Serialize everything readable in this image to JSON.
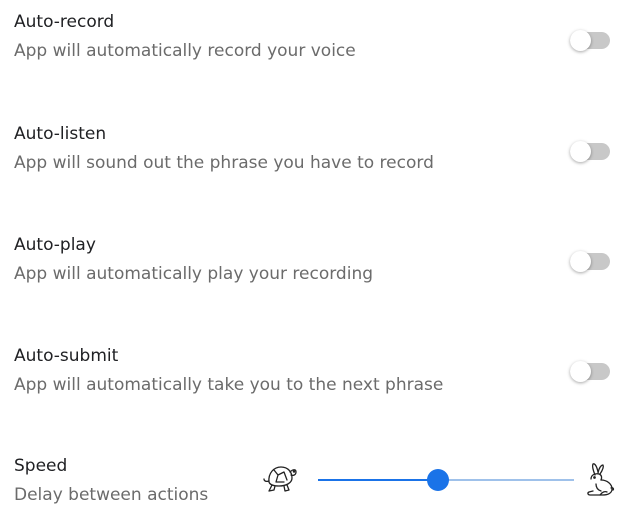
{
  "settings": [
    {
      "title": "Auto-record",
      "description": "App will automatically record your voice",
      "enabled": false
    },
    {
      "title": "Auto-listen",
      "description": "App will sound out the phrase you have to record",
      "enabled": false
    },
    {
      "title": "Auto-play",
      "description": "App will automatically play your recording",
      "enabled": false
    },
    {
      "title": "Auto-submit",
      "description": "App will automatically take you to the next phrase",
      "enabled": false
    }
  ],
  "speed": {
    "title": "Speed",
    "description": "Delay between actions",
    "value": 0.47,
    "min_icon": "turtle-icon",
    "max_icon": "rabbit-icon"
  },
  "colors": {
    "accent": "#1a73e8",
    "track": "#9fc1ea",
    "toggle_off": "#c8c8c8"
  }
}
